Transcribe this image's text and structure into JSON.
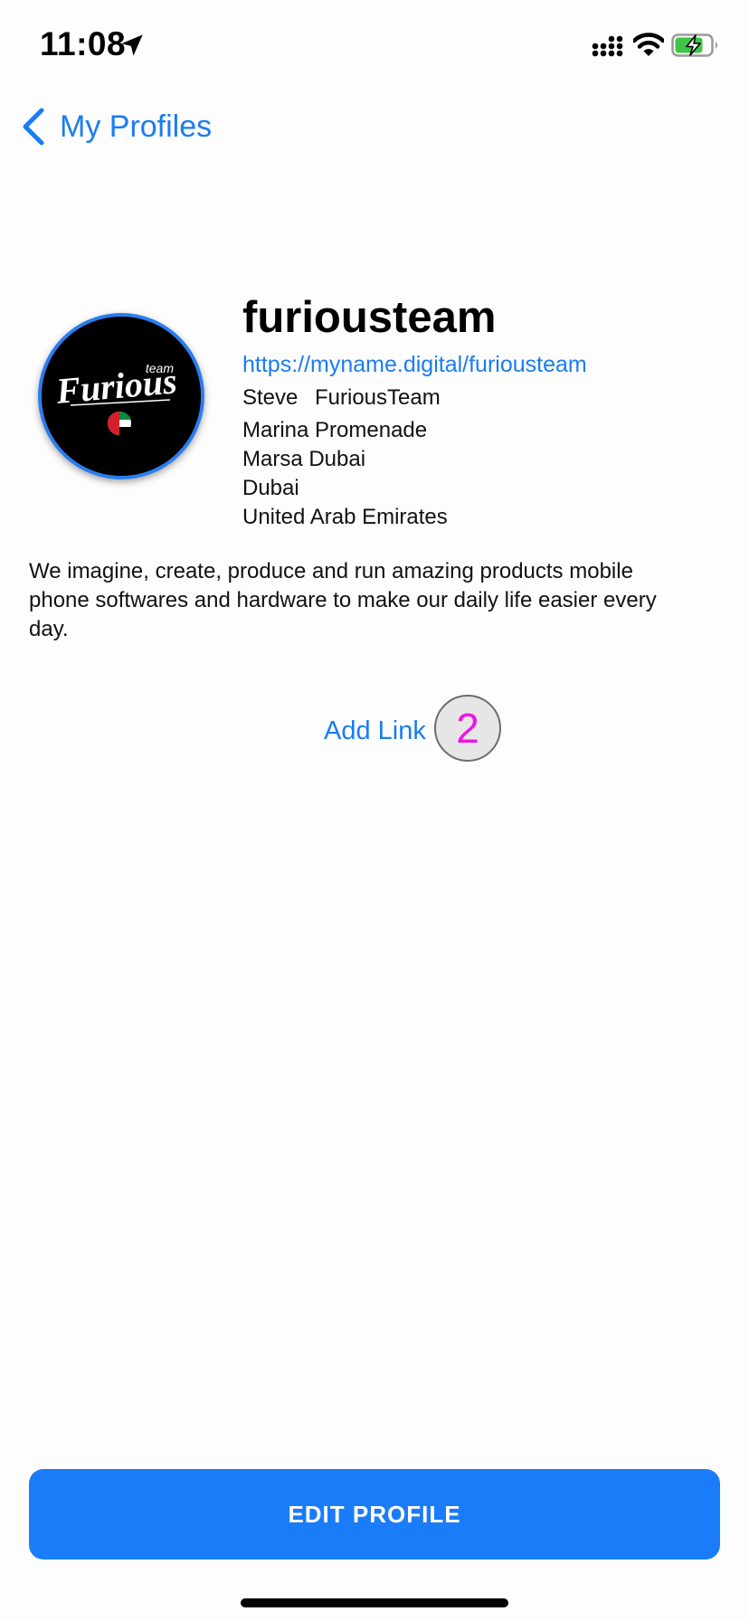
{
  "status_bar": {
    "time": "11:08"
  },
  "nav": {
    "back_label": "My Profiles"
  },
  "avatar": {
    "logo_text": "Furious",
    "logo_small_text": "team"
  },
  "profile": {
    "username": "furiousteam",
    "url": "https://myname.digital/furiousteam",
    "first_name": "Steve",
    "last_name": "FuriousTeam",
    "address": [
      "Marina Promenade",
      "Marsa Dubai",
      "Dubai",
      "United Arab Emirates"
    ],
    "bio": "We imagine, create, produce and run amazing products mobile phone softwares and hardware to make our daily life easier every day."
  },
  "links": {
    "add_label": "Add Link",
    "count": "2"
  },
  "actions": {
    "edit_label": "EDIT PROFILE"
  },
  "colors": {
    "accent": "#1a7cf3",
    "button": "#1a7cf9",
    "badge_text": "#ee14e6"
  }
}
